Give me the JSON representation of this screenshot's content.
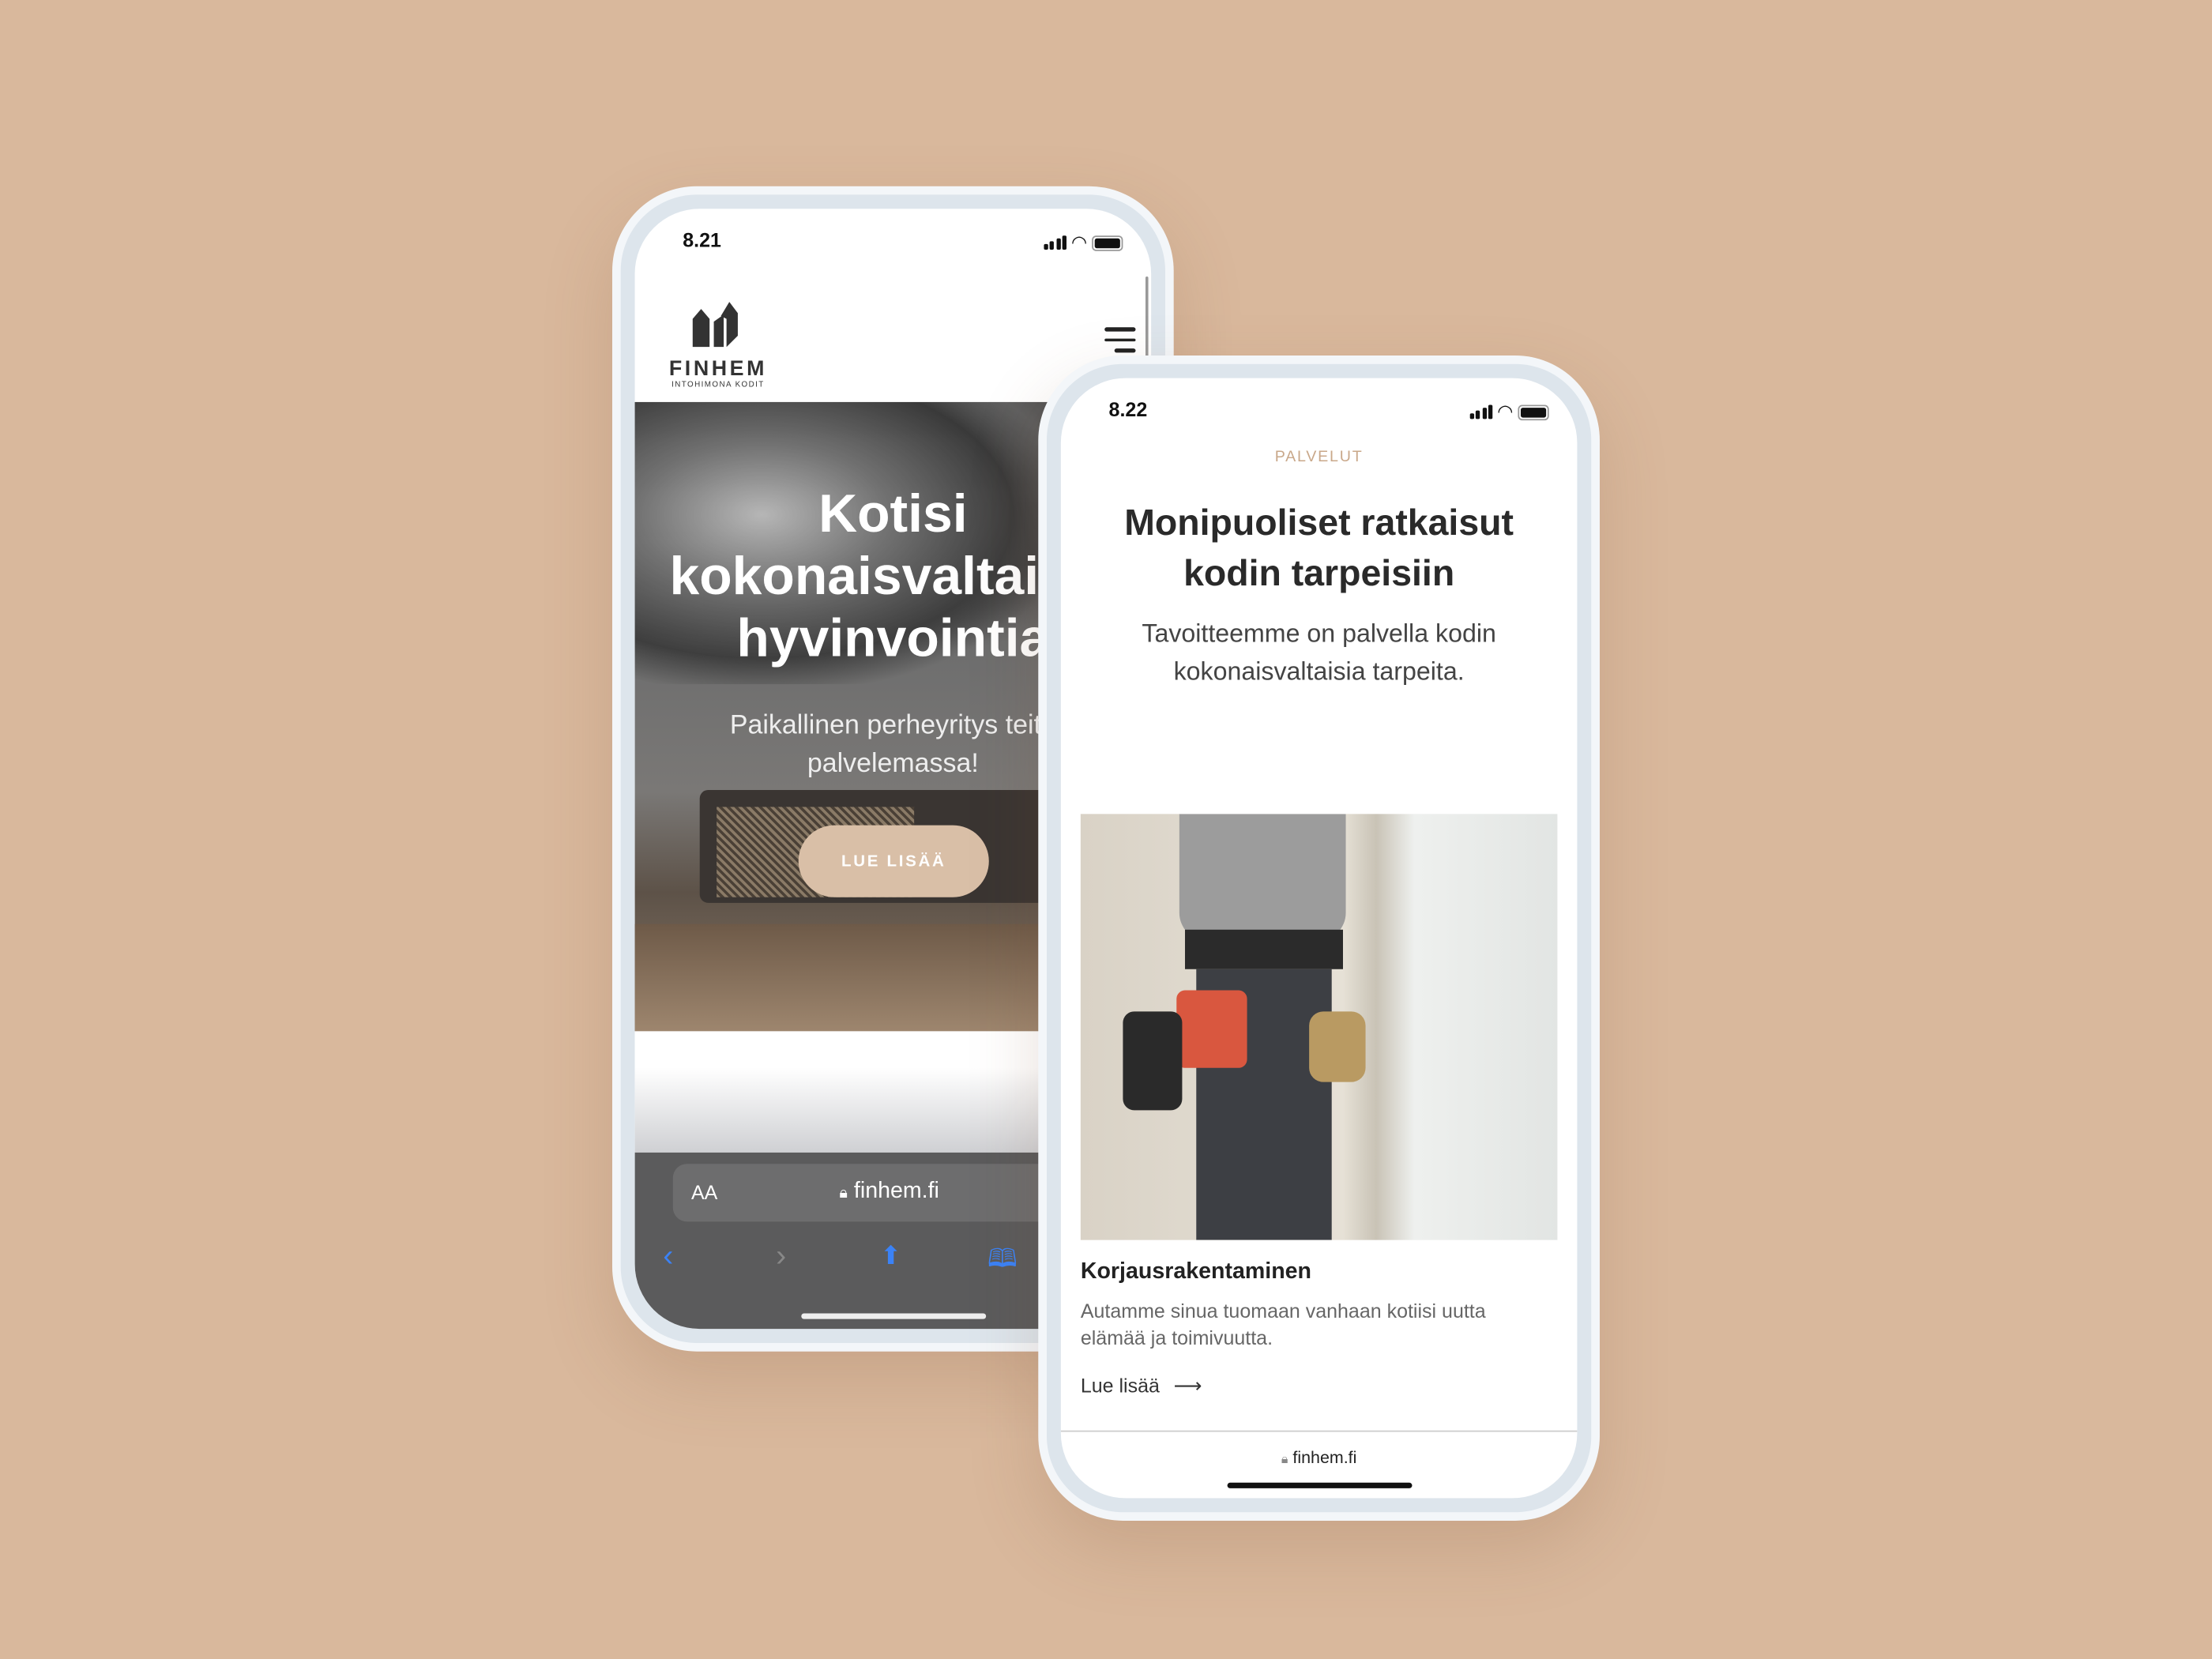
{
  "phone1": {
    "status_time": "8.21",
    "logo": {
      "brand": "FINHEM",
      "tagline": "INTOHIMONA KODIT"
    },
    "hero": {
      "title_lines": [
        "Kotisi",
        "kokonaisvaltaista",
        "hyvinvointia"
      ],
      "subtitle_lines": [
        "Paikallinen perheyritys teitä",
        "palvelemassa!"
      ],
      "cta": "LUE LISÄÄ"
    },
    "browser": {
      "text_size": "AA",
      "url": "finhem.fi"
    }
  },
  "phone2": {
    "status_time": "8.22",
    "eyebrow": "PALVELUT",
    "heading_lines": [
      "Monipuoliset ratkaisut",
      "kodin tarpeisiin"
    ],
    "intro_lines": [
      "Tavoitteemme on palvella kodin",
      "kokonaisvaltaisia tarpeita."
    ],
    "card": {
      "title": "Korjausrakentaminen",
      "description": "Autamme sinua tuomaan vanhaan kotiisi uutta elämää ja toimivuutta.",
      "link": "Lue lisää",
      "link_arrow": "⟶"
    },
    "url": "finhem.fi"
  },
  "colors": {
    "background": "#d9b89c",
    "accent": "#d9bfa7",
    "eyebrow": "#c9a88a"
  }
}
